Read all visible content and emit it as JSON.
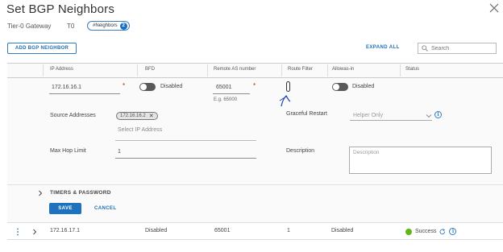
{
  "dialog": {
    "title": "Set BGP Neighbors",
    "gateway_label": "Tier-0 Gateway",
    "gateway_value": "T0",
    "badge_label": "#Neighbors",
    "badge_count": "2"
  },
  "toolbar": {
    "add_label": "ADD BGP NEIGHBOR",
    "expand_all_label": "EXPAND ALL",
    "search_placeholder": "Search"
  },
  "columns": [
    "IP Address",
    "BFD",
    "Remote AS number",
    "Route Filter",
    "Allowas-in",
    "Status"
  ],
  "edit_row": {
    "ip_address": "172.16.16.1",
    "bfd_label": "Disabled",
    "remote_as": "65001",
    "remote_as_hint": "E.g. 65000",
    "route_filter": "0",
    "allowas_label": "Disabled",
    "source_addresses_label": "Source Addresses",
    "source_address_tag": "172.16.16.2",
    "select_ip_placeholder": "Select IP Address",
    "graceful_restart_label": "Graceful Restart",
    "graceful_restart_value": "Helper Only",
    "max_hop_label": "Max Hop Limit",
    "max_hop_value": "1",
    "description_label": "Description",
    "description_placeholder": "Description",
    "timers_label": "TIMERS & PASSWORD",
    "save_label": "SAVE",
    "cancel_label": "CANCEL"
  },
  "rows": [
    {
      "ip_address": "172.16.17.1",
      "bfd": "Disabled",
      "remote_as": "65001",
      "route_filter": "1",
      "allowas_in": "Disabled",
      "status": "Success"
    }
  ],
  "colors": {
    "accent": "#1e72bd",
    "success": "#5eb715",
    "required": "#c92100"
  }
}
